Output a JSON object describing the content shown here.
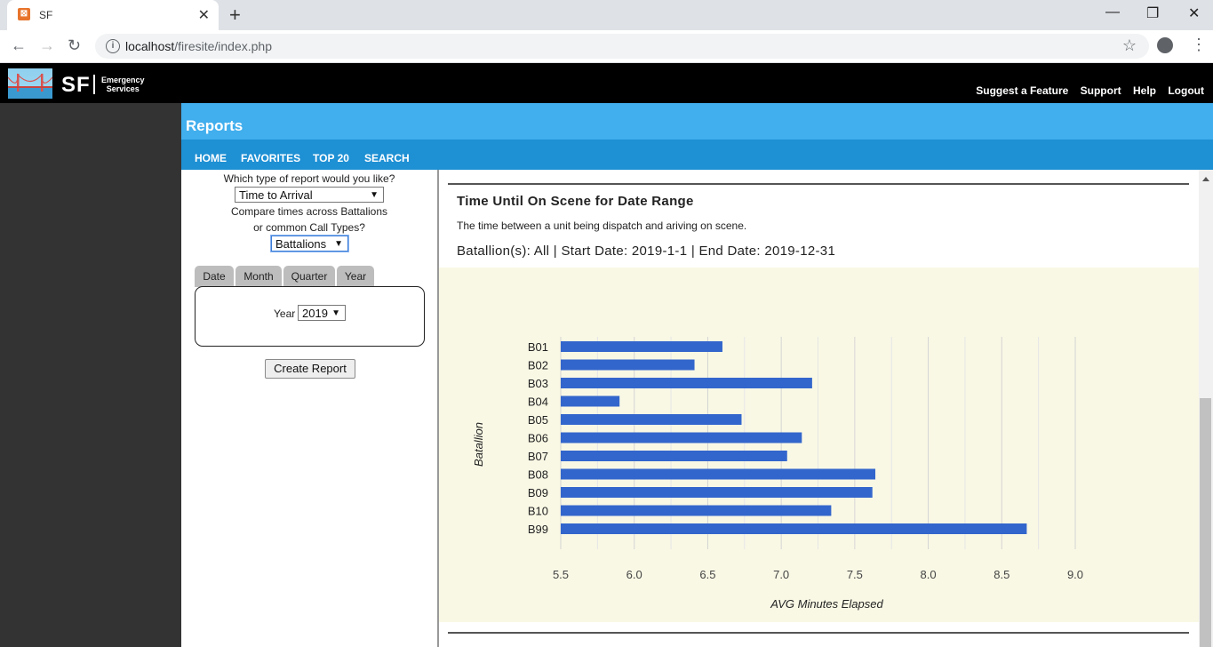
{
  "browser": {
    "tab_title": "SF",
    "tab_favicon": "xampp-icon",
    "url_host": "localhost",
    "url_path": "/firesite/index.php"
  },
  "site": {
    "logo_text": "SF",
    "logo_sub_line1": "Emergency",
    "logo_sub_line2": "Services",
    "header_links": [
      "Suggest a Feature",
      "Support",
      "Help",
      "Logout"
    ]
  },
  "reports": {
    "title": "Reports",
    "nav": [
      "HOME",
      "FAVORITES",
      "TOP 20",
      "SEARCH"
    ]
  },
  "form": {
    "question": "Which type of report would you like?",
    "report_type": "Time to Arrival",
    "compare_line1": "Compare times across Battalions",
    "compare_line2": "or common Call Types?",
    "compare_value": "Battalions",
    "tabs": [
      "Date",
      "Month",
      "Quarter",
      "Year"
    ],
    "year_label": "Year",
    "year_value": "2019",
    "create_button": "Create Report"
  },
  "report": {
    "title": "Time Until On Scene for Date Range",
    "description": "The time between a unit being dispatch and ariving on scene.",
    "params": "Batallion(s): All | Start Date: 2019-1-1 | End Date: 2019-12-31"
  },
  "colors": {
    "bar": "#3366cc",
    "chart_bg": "#f9f8e5",
    "reports_bar": "#41aeed",
    "nav_bar": "#1e90d4"
  },
  "chart_data": {
    "type": "bar",
    "orientation": "horizontal",
    "categories": [
      "B01",
      "B02",
      "B03",
      "B04",
      "B05",
      "B06",
      "B07",
      "B08",
      "B09",
      "B10",
      "B99"
    ],
    "values": [
      6.6,
      6.41,
      7.21,
      5.9,
      6.73,
      7.14,
      7.04,
      7.64,
      7.62,
      7.34,
      8.67
    ],
    "xlabel": "AVG Minutes Elapsed",
    "ylabel": "Batallion",
    "xlim": [
      5.5,
      9.0
    ],
    "xticks": [
      "5.5",
      "6.0",
      "6.5",
      "7.0",
      "7.5",
      "8.0",
      "8.5",
      "9.0"
    ],
    "grid": true,
    "legend": "none"
  }
}
